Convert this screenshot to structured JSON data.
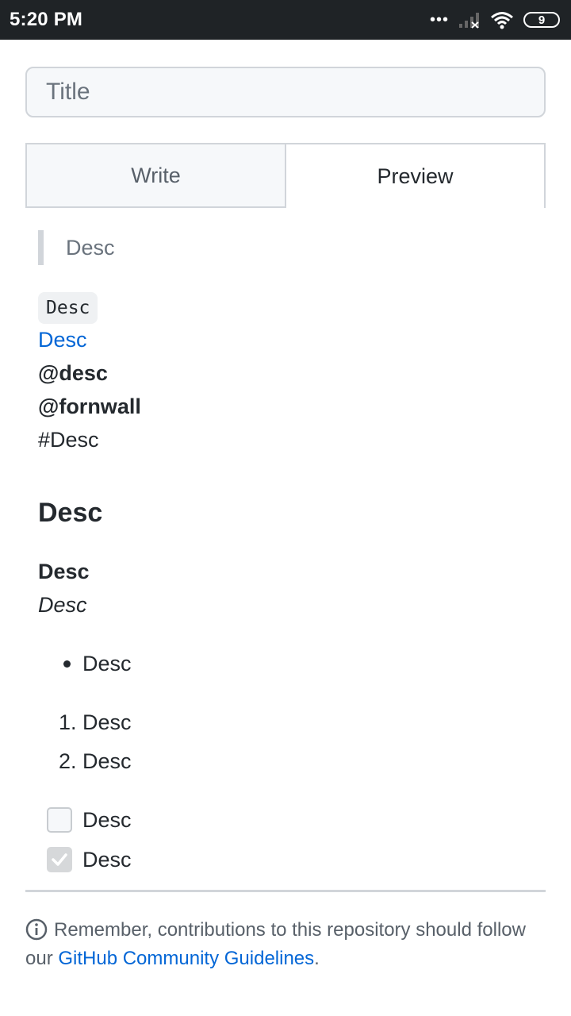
{
  "status_bar": {
    "time": "5:20 PM",
    "dots": "•••",
    "battery": "9"
  },
  "title_input": {
    "placeholder": "Title",
    "value": ""
  },
  "tabs": {
    "write": "Write",
    "preview": "Preview"
  },
  "preview": {
    "blockquote": "Desc",
    "code": "Desc",
    "link": "Desc",
    "mention_1": "@desc",
    "mention_2": "@fornwall",
    "hashtag": "#Desc",
    "heading": "Desc",
    "bold": "Desc",
    "italic": "Desc",
    "bullet_items": [
      "Desc"
    ],
    "ordered_items": [
      {
        "marker": "1.",
        "text": "Desc"
      },
      {
        "marker": "2.",
        "text": "Desc"
      }
    ],
    "tasks": [
      {
        "checked": false,
        "text": "Desc"
      },
      {
        "checked": true,
        "text": "Desc"
      }
    ]
  },
  "footer": {
    "text": "Remember, contributions to this repository should follow our",
    "link": "GitHub Community Guidelines",
    "end": "."
  },
  "colors": {
    "link": "#0366d6",
    "status_bar": "#1f2326",
    "border": "#d1d5da"
  }
}
